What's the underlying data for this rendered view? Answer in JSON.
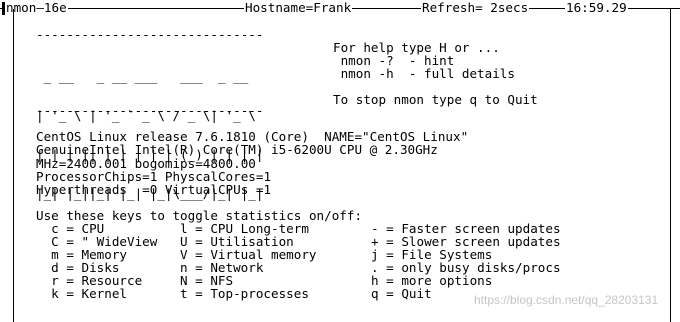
{
  "titlebar": {
    "app": "nmon—16e",
    "hostname": "Hostname=Frank",
    "refresh": "Refresh= 2secs",
    "clock": "16:59.29"
  },
  "banner": {
    "divider": "------------------------------",
    "logo_lines": [
      " _ __   _ __ ___   ___  _ __",
      "| '_ \\ | '_ ` _ \\ / _ \\| '_ \\",
      "| | | || | | | | | (_) | | | |",
      "|_| |_||_| |_| |_|\\___/|_| |_|"
    ]
  },
  "help": {
    "line1": "For help type H or ...",
    "line2": " nmon -?  - hint",
    "line3": " nmon -h  - full details",
    "line4": "To stop nmon type q to Quit"
  },
  "sysinfo": {
    "os": "CentOS Linux release 7.6.1810 (Core)  NAME=\"CentOS Linux\"",
    "cpu": "GenuineIntel Intel(R) Core(TM) i5-6200U CPU @ 2.30GHz",
    "mhz": "MHz=2400.001 bogomips=4800.00",
    "chips": "ProcessorChips=1 PhyscalCores=1",
    "threads": "Hyperthreads  =0 VirtualCPUs =1"
  },
  "keys": {
    "heading": "Use these keys to toggle statistics on/off:",
    "rows": [
      [
        "  c = CPU",
        "l = CPU Long-term",
        "- = Faster screen updates"
      ],
      [
        "  C = \" WideView",
        "U = Utilisation",
        "+ = Slower screen updates"
      ],
      [
        "  m = Memory",
        "V = Virtual memory",
        "j = File Systems"
      ],
      [
        "  d = Disks",
        "n = Network",
        ". = only busy disks/procs"
      ],
      [
        "  r = Resource",
        "N = NFS",
        "h = more options"
      ],
      [
        "  k = Kernel",
        "t = Top-processes",
        "q = Quit"
      ]
    ]
  },
  "watermark": "https://blog.csdn.net/qq_28203131"
}
